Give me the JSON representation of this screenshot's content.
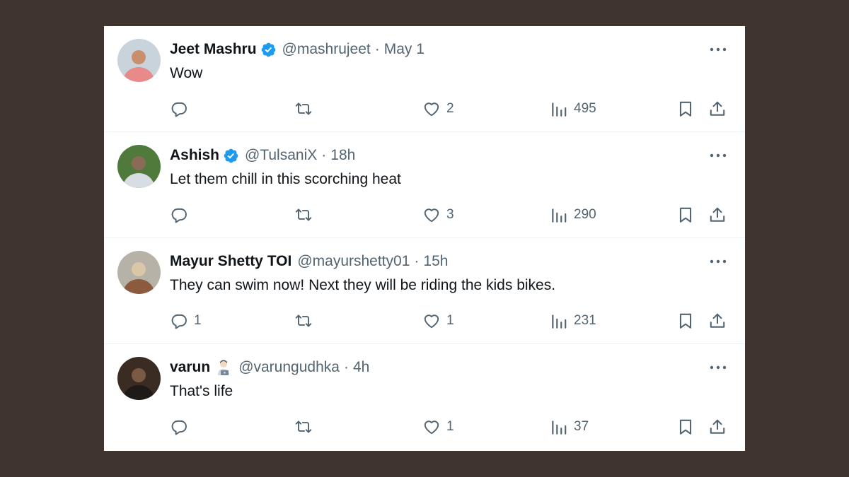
{
  "tweets": [
    {
      "name": "Jeet Mashru",
      "verified": true,
      "emoji": null,
      "handle": "@mashrujeet",
      "sep": "·",
      "time": "May 1",
      "text": "Wow",
      "replies": "",
      "retweets": "",
      "likes": "2",
      "views": "495",
      "avatar_colors": {
        "bg": "#c9d3dc",
        "shirt": "#e88a8a",
        "skin": "#c98f6c"
      }
    },
    {
      "name": "Ashish",
      "verified": true,
      "emoji": null,
      "handle": "@TulsaniX",
      "sep": "·",
      "time": "18h",
      "text": "Let them chill in this scorching heat",
      "replies": "",
      "retweets": "",
      "likes": "3",
      "views": "290",
      "avatar_colors": {
        "bg": "#4f7a3c",
        "shirt": "#d8dde4",
        "skin": "#8a6b55"
      }
    },
    {
      "name": "Mayur Shetty TOI",
      "verified": false,
      "emoji": null,
      "handle": "@mayurshetty01",
      "sep": "·",
      "time": "15h",
      "text": "They can swim now! Next they will be riding the kids bikes.",
      "replies": "1",
      "retweets": "",
      "likes": "1",
      "views": "231",
      "avatar_colors": {
        "bg": "#b7b2a8",
        "shirt": "#8c5a3c",
        "skin": "#d9c7a8"
      }
    },
    {
      "name": "varun",
      "verified": false,
      "emoji": "technologist-emoji",
      "handle": "@varungudhka",
      "sep": "·",
      "time": "4h",
      "text": "That's life",
      "replies": "",
      "retweets": "",
      "likes": "1",
      "views": "37",
      "avatar_colors": {
        "bg": "#3a2c22",
        "shirt": "#1e1a17",
        "skin": "#7a5a44"
      }
    }
  ],
  "colors": {
    "backdrop": "#40342f",
    "text": "#0f1419",
    "muted": "#536471",
    "verified": "#1d9bf0"
  }
}
